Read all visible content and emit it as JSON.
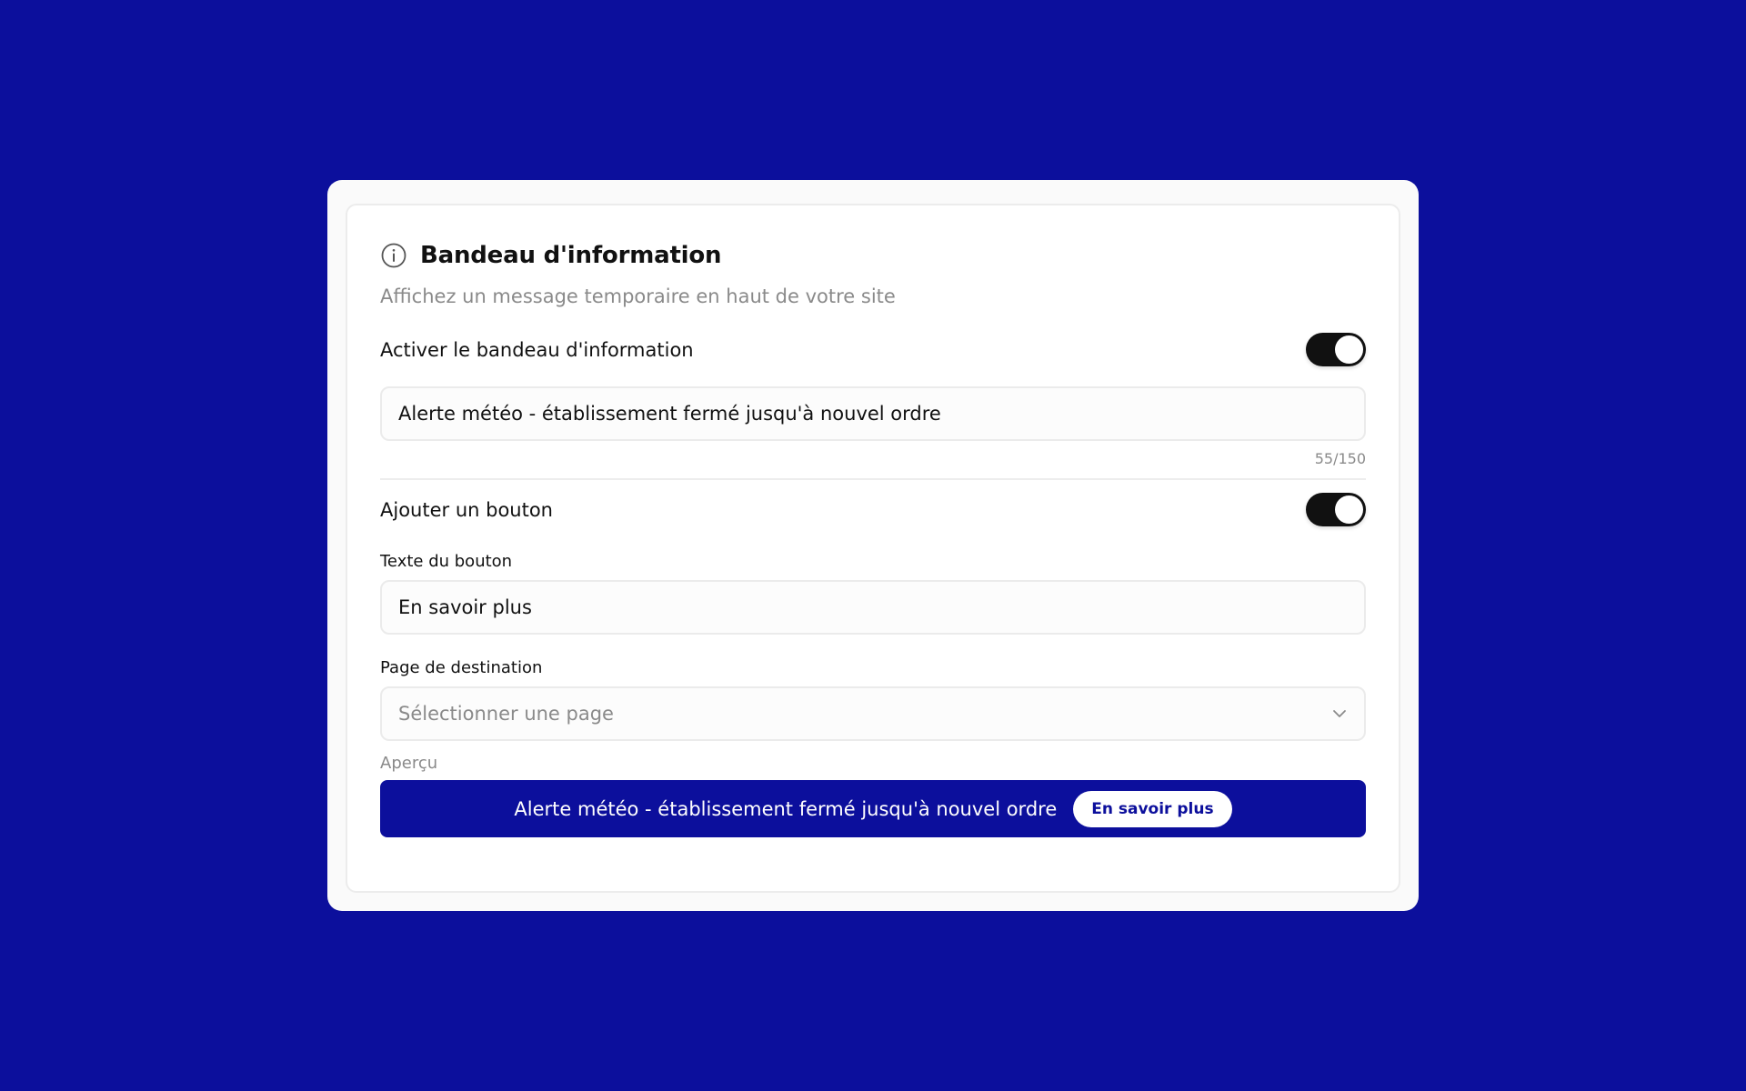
{
  "colors": {
    "background": "#0c0f9c",
    "accent": "#0c0f9c",
    "toggle_on": "#111111"
  },
  "panel": {
    "icon": "info-icon",
    "title": "Bandeau d'information",
    "subtitle": "Affichez un message temporaire en haut de votre site"
  },
  "banner_toggle": {
    "label": "Activer le bandeau d'information",
    "enabled": true
  },
  "message_input": {
    "value": "Alerte météo - établissement fermé jusqu'à nouvel ordre",
    "counter": "55/150"
  },
  "button_toggle": {
    "label": "Ajouter un bouton",
    "enabled": true
  },
  "button_text": {
    "label": "Texte du bouton",
    "value": "En savoir plus"
  },
  "destination": {
    "label": "Page de destination",
    "placeholder": "Sélectionner une page",
    "icon": "chevron-down-icon"
  },
  "preview": {
    "label": "Aperçu",
    "message": "Alerte météo - établissement fermé jusqu'à nouvel ordre",
    "button_label": "En savoir plus"
  }
}
